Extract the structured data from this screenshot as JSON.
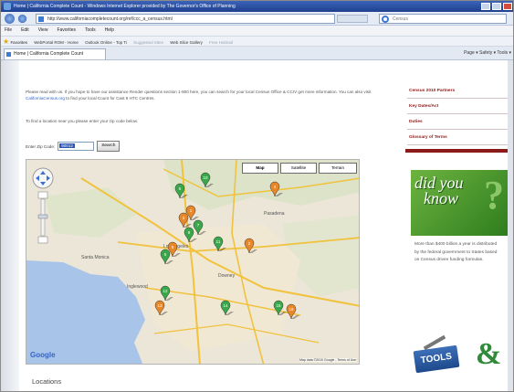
{
  "window": {
    "title": "Home | California Complete Count - Windows Internet Explorer provided by The Governor's Office of Planning"
  },
  "address_bar": {
    "url": "http://www.californiacompletecount.org/ref/ccc_a_census.html",
    "search_placeholder": "Census"
  },
  "menu": {
    "items": [
      "File",
      "Edit",
      "View",
      "Favorites",
      "Tools",
      "Help"
    ]
  },
  "favorites_bar": {
    "label": "Favorites",
    "links": [
      {
        "label": "WebPortal ROM - Home",
        "dim": false
      },
      {
        "label": "Outlook Online - Top Ti",
        "dim": false
      },
      {
        "label": "Suggested Sites",
        "dim": true
      },
      {
        "label": "Web Slice Gallery",
        "dim": false
      },
      {
        "label": "Free Hotmail",
        "dim": true
      }
    ]
  },
  "tab": {
    "label": "Home | California Complete Count"
  },
  "command_bar": {
    "text": "Page ▾  Safety ▾  Tools ▾"
  },
  "intro": {
    "para1_a": "Please read with us. If you hope to have our assistance Render questions section 1-800 here, you can search for your local Census Office & CCIV get more information. You can also visit ",
    "para1_link": "CaliforniaCensus.org",
    "para1_b": " to find your local Count for Cast 9 HTC Centres.",
    "para2": "To find a location near you please enter your zip code below."
  },
  "zip_search": {
    "label": "Enter Zip Code:",
    "value": "90012",
    "button": "Search"
  },
  "map": {
    "types": [
      "Map",
      "Satellite",
      "Terrain"
    ],
    "active_type": "Map",
    "logo": "Google",
    "terms": "Map data ©2010 Google - Terms of Use",
    "marker_colors": {
      "green": "#3aa84a",
      "orange": "#e8862a"
    },
    "markers": [
      {
        "label": "6",
        "color": "green"
      },
      {
        "label": "10",
        "color": "green"
      },
      {
        "label": "4",
        "color": "orange"
      },
      {
        "label": "1",
        "color": "orange"
      },
      {
        "label": "3",
        "color": "orange"
      },
      {
        "label": "7",
        "color": "green"
      },
      {
        "label": "9",
        "color": "green"
      },
      {
        "label": "2",
        "color": "orange"
      },
      {
        "label": "11",
        "color": "green"
      },
      {
        "label": "8",
        "color": "orange"
      },
      {
        "label": "5",
        "color": "green"
      },
      {
        "label": "12",
        "color": "green"
      },
      {
        "label": "13",
        "color": "orange"
      },
      {
        "label": "14",
        "color": "green"
      },
      {
        "label": "15",
        "color": "green"
      },
      {
        "label": "16",
        "color": "orange"
      }
    ]
  },
  "locations_heading": "Locations",
  "sidebar": {
    "items": [
      "Census 2010 Partners",
      "Key Dates/Act",
      "Duties",
      "Glossary of Terms"
    ],
    "accent": "#8b1a1a"
  },
  "did_you_know": {
    "line1": "did you",
    "line2": "know",
    "q": "?"
  },
  "fact": "More than $400 billion a year is distributed by the federal government to States based on Census driven funding formulas.",
  "tools_badge": {
    "label": "TOOLS",
    "amp": "&"
  }
}
